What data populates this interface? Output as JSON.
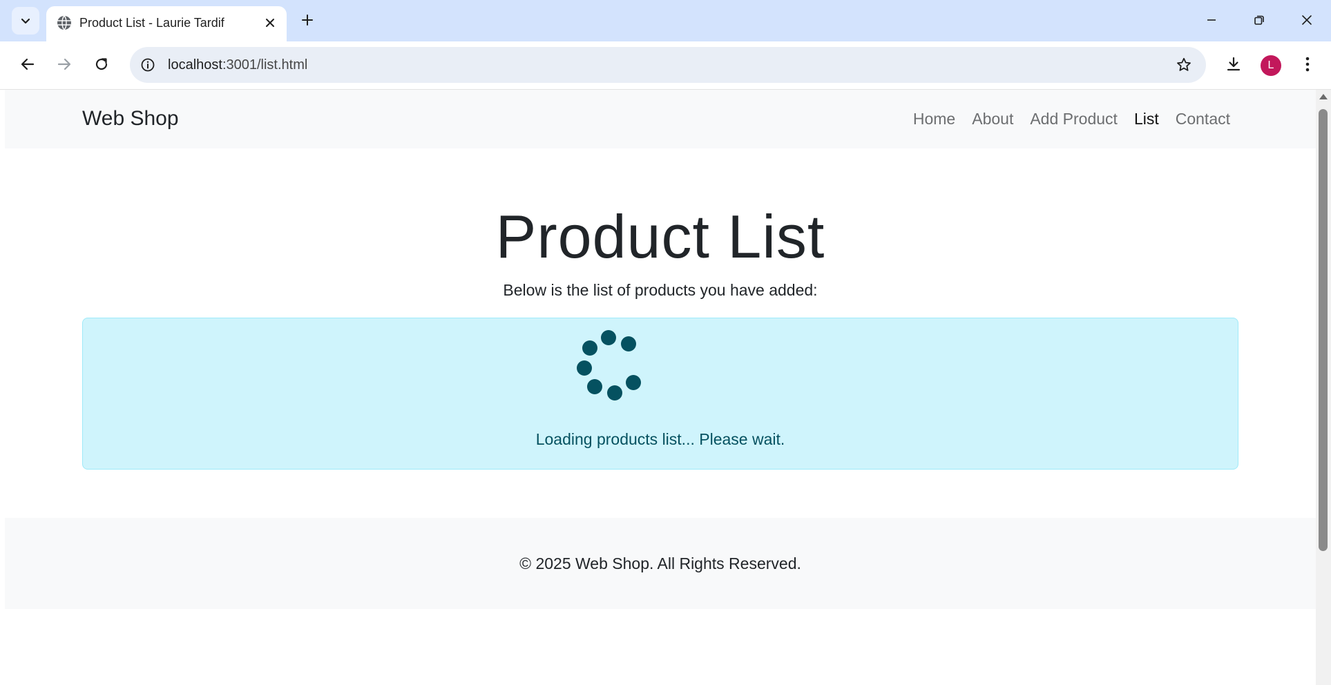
{
  "browser": {
    "tab_title": "Product List - Laurie Tardif",
    "url_host": "localhost",
    "url_path": ":3001/list.html",
    "profile_initial": "L",
    "profile_color": "#c2185b"
  },
  "page": {
    "brand": "Web Shop",
    "nav": [
      {
        "label": "Home",
        "active": false
      },
      {
        "label": "About",
        "active": false
      },
      {
        "label": "Add Product",
        "active": false
      },
      {
        "label": "List",
        "active": true
      },
      {
        "label": "Contact",
        "active": false
      }
    ],
    "title": "Product List",
    "subtitle": "Below is the list of products you have added:",
    "loading": {
      "message": "Loading products list... Please wait.",
      "alert_bg": "#cff4fc",
      "text_color": "#055160"
    },
    "footer": "© 2025 Web Shop. All Rights Reserved."
  }
}
